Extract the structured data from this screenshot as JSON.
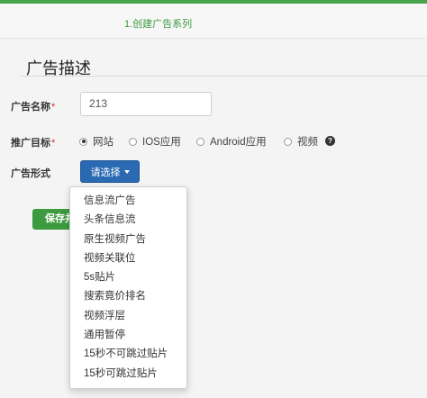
{
  "steps": {
    "active_label": "1.创建广告系列"
  },
  "section": {
    "title": "广告描述"
  },
  "form": {
    "ad_name": {
      "label": "广告名称",
      "required_mark": "*",
      "value": "213"
    },
    "target": {
      "label": "推广目标",
      "required_mark": "*",
      "options": [
        "网站",
        "IOS应用",
        "Android应用",
        "视频"
      ],
      "selected": "网站",
      "help_icon_glyph": "?"
    },
    "ad_format": {
      "label": "广告形式",
      "button_label": "请选择"
    },
    "save_label": "保存并"
  },
  "dropdown": {
    "items": [
      "信息流广告",
      "头条信息流",
      "原生视频广告",
      "视频关联位",
      "5s贴片",
      "搜索竟价排名",
      "视频浮层",
      "通用暂停",
      "15秒不可跳过贴片",
      "15秒可跳过贴片"
    ]
  },
  "colors": {
    "accent_green": "#3c9b3e",
    "button_blue": "#2a6ab2",
    "required_red": "#c9302c"
  },
  "icons": {
    "help": "question-circle-icon",
    "caret": "caret-down-icon"
  }
}
